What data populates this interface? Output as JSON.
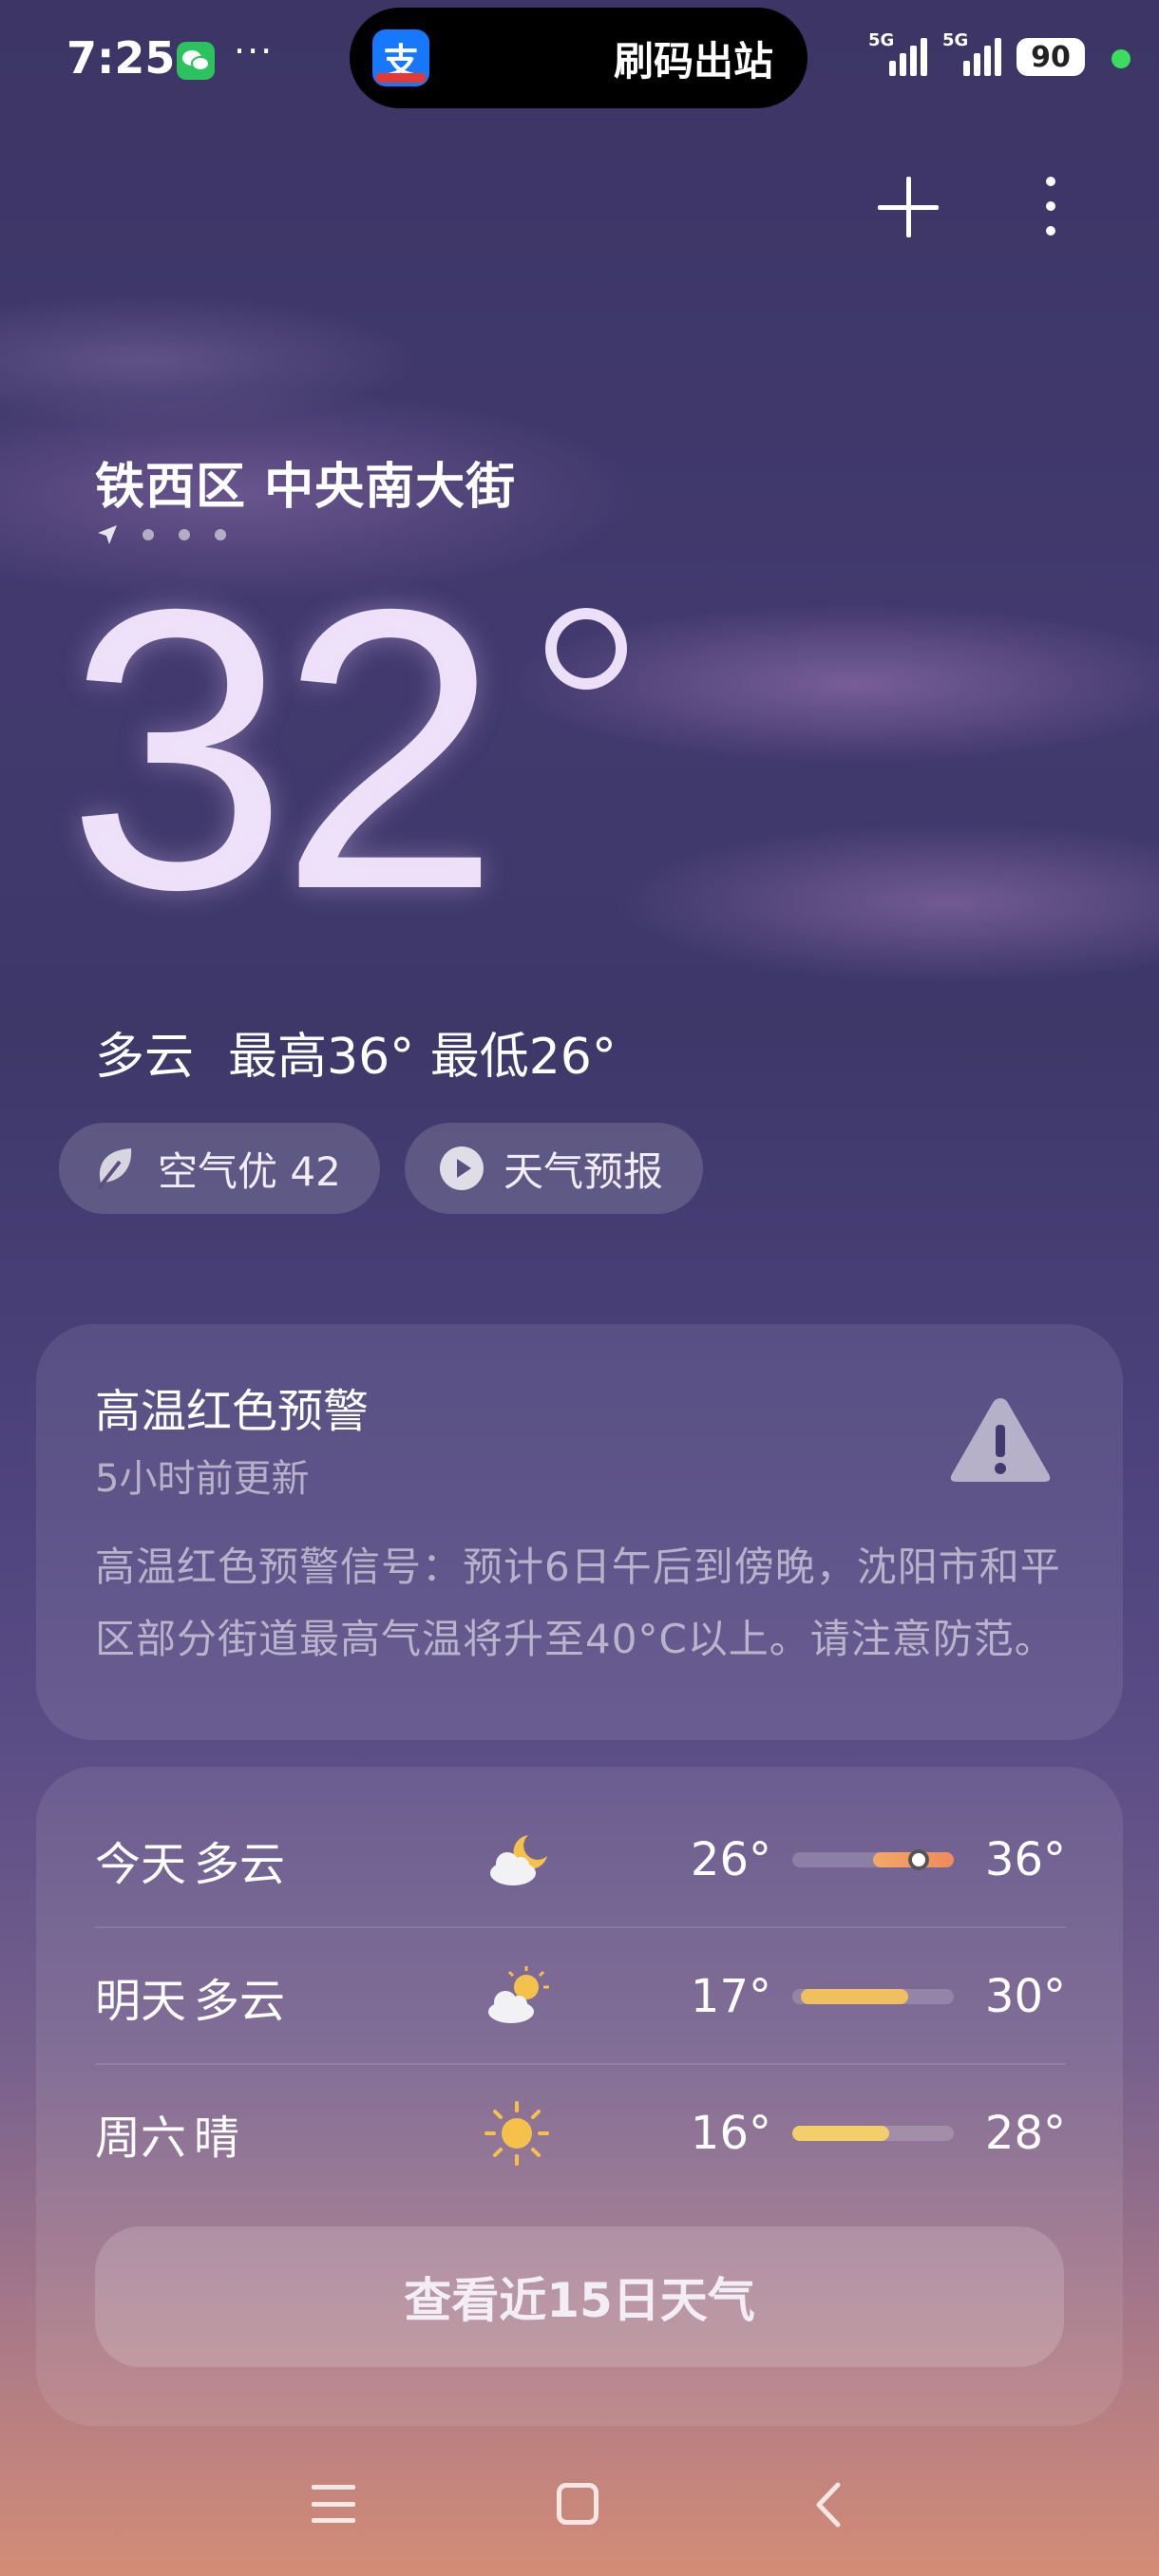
{
  "status_bar": {
    "time": "7:25",
    "dots": "···",
    "island_text": "刷码出站",
    "alipay_glyph": "支",
    "signal1_label": "5G",
    "signal2_label": "5G",
    "battery": "90"
  },
  "location": {
    "name": "铁西区 中央南大街",
    "pages": 4
  },
  "current": {
    "temperature": "32",
    "condition": "多云",
    "high_low": "最高36° 最低26°"
  },
  "pills": {
    "air_quality": "空气优 42",
    "forecast": "天气预报"
  },
  "warning": {
    "title": "高温红色预警",
    "updated": "5小时前更新",
    "body": "高温红色预警信号：预计6日午后到傍晚，沈阳市和平区部分街道最高气温将升至40°C以上。请注意防范。"
  },
  "forecast": [
    {
      "day": "今天",
      "condition": "多云",
      "icon": "cloudy-night-icon",
      "low": "26°",
      "high": "36°",
      "range_from": 0.5,
      "range_to": 1.0,
      "now": 0.78,
      "color": "#f08a5a"
    },
    {
      "day": "明天",
      "condition": "多云",
      "icon": "partly-cloudy-icon",
      "low": "17°",
      "high": "30°",
      "range_from": 0.05,
      "range_to": 0.72,
      "color": "#f0c060"
    },
    {
      "day": "周六",
      "condition": "晴",
      "icon": "sun-icon",
      "low": "16°",
      "high": "28°",
      "range_from": 0.0,
      "range_to": 0.6,
      "color": "#f2cf6a"
    }
  ],
  "fifteen_day_button": "查看近15日天气"
}
